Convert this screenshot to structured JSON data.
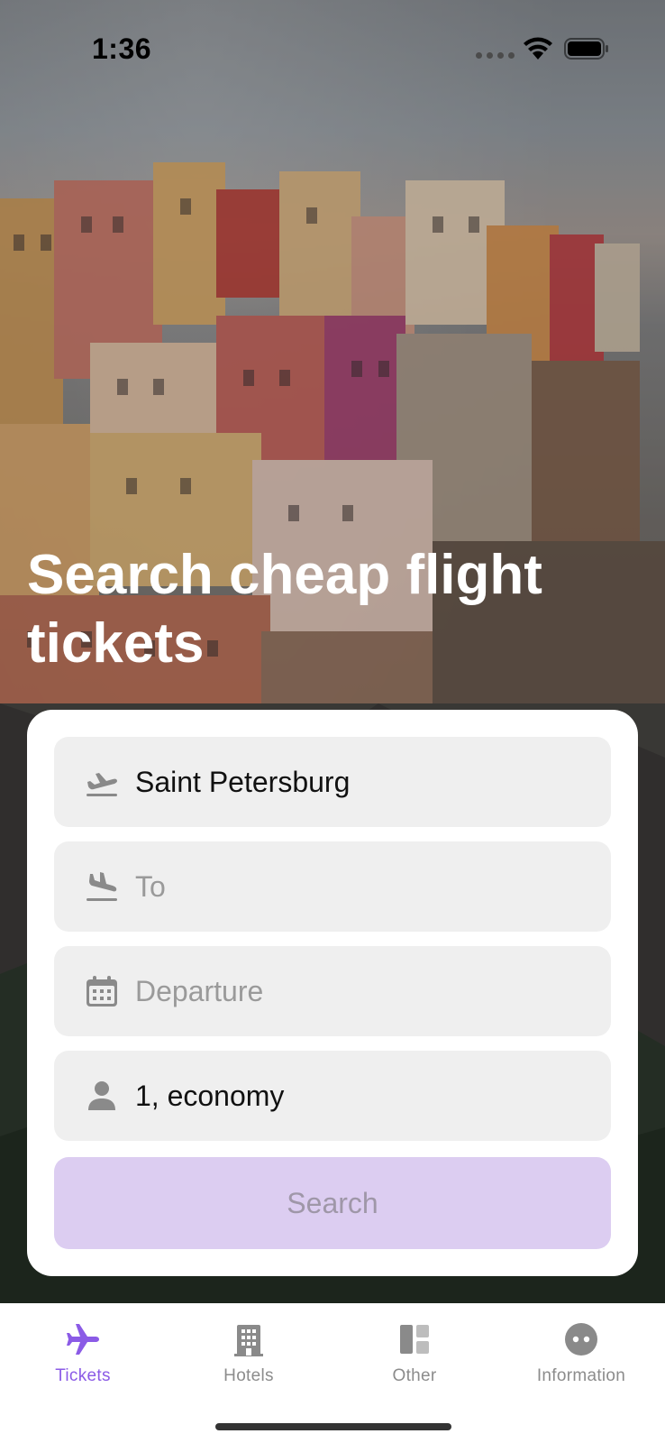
{
  "status_bar": {
    "time": "1:36",
    "icons": [
      "wifi-icon",
      "battery-icon"
    ]
  },
  "hero": {
    "title": "Search cheap flight tickets"
  },
  "form": {
    "from": {
      "value": "Saint Petersburg",
      "icon": "plane-departure-icon"
    },
    "to": {
      "placeholder": "To",
      "icon": "plane-arrival-icon"
    },
    "departure": {
      "placeholder": "Departure",
      "icon": "calendar-icon"
    },
    "passengers": {
      "value": "1, economy",
      "icon": "person-icon"
    },
    "search_label": "Search"
  },
  "tabs": [
    {
      "label": "Tickets",
      "icon": "plane-icon",
      "active": true
    },
    {
      "label": "Hotels",
      "icon": "building-icon",
      "active": false
    },
    {
      "label": "Other",
      "icon": "grid-icon",
      "active": false
    },
    {
      "label": "Information",
      "icon": "info-chat-icon",
      "active": false
    }
  ],
  "colors": {
    "accent": "#8b5be6",
    "search_button_bg": "#dccdf1",
    "field_bg": "#efefef"
  }
}
